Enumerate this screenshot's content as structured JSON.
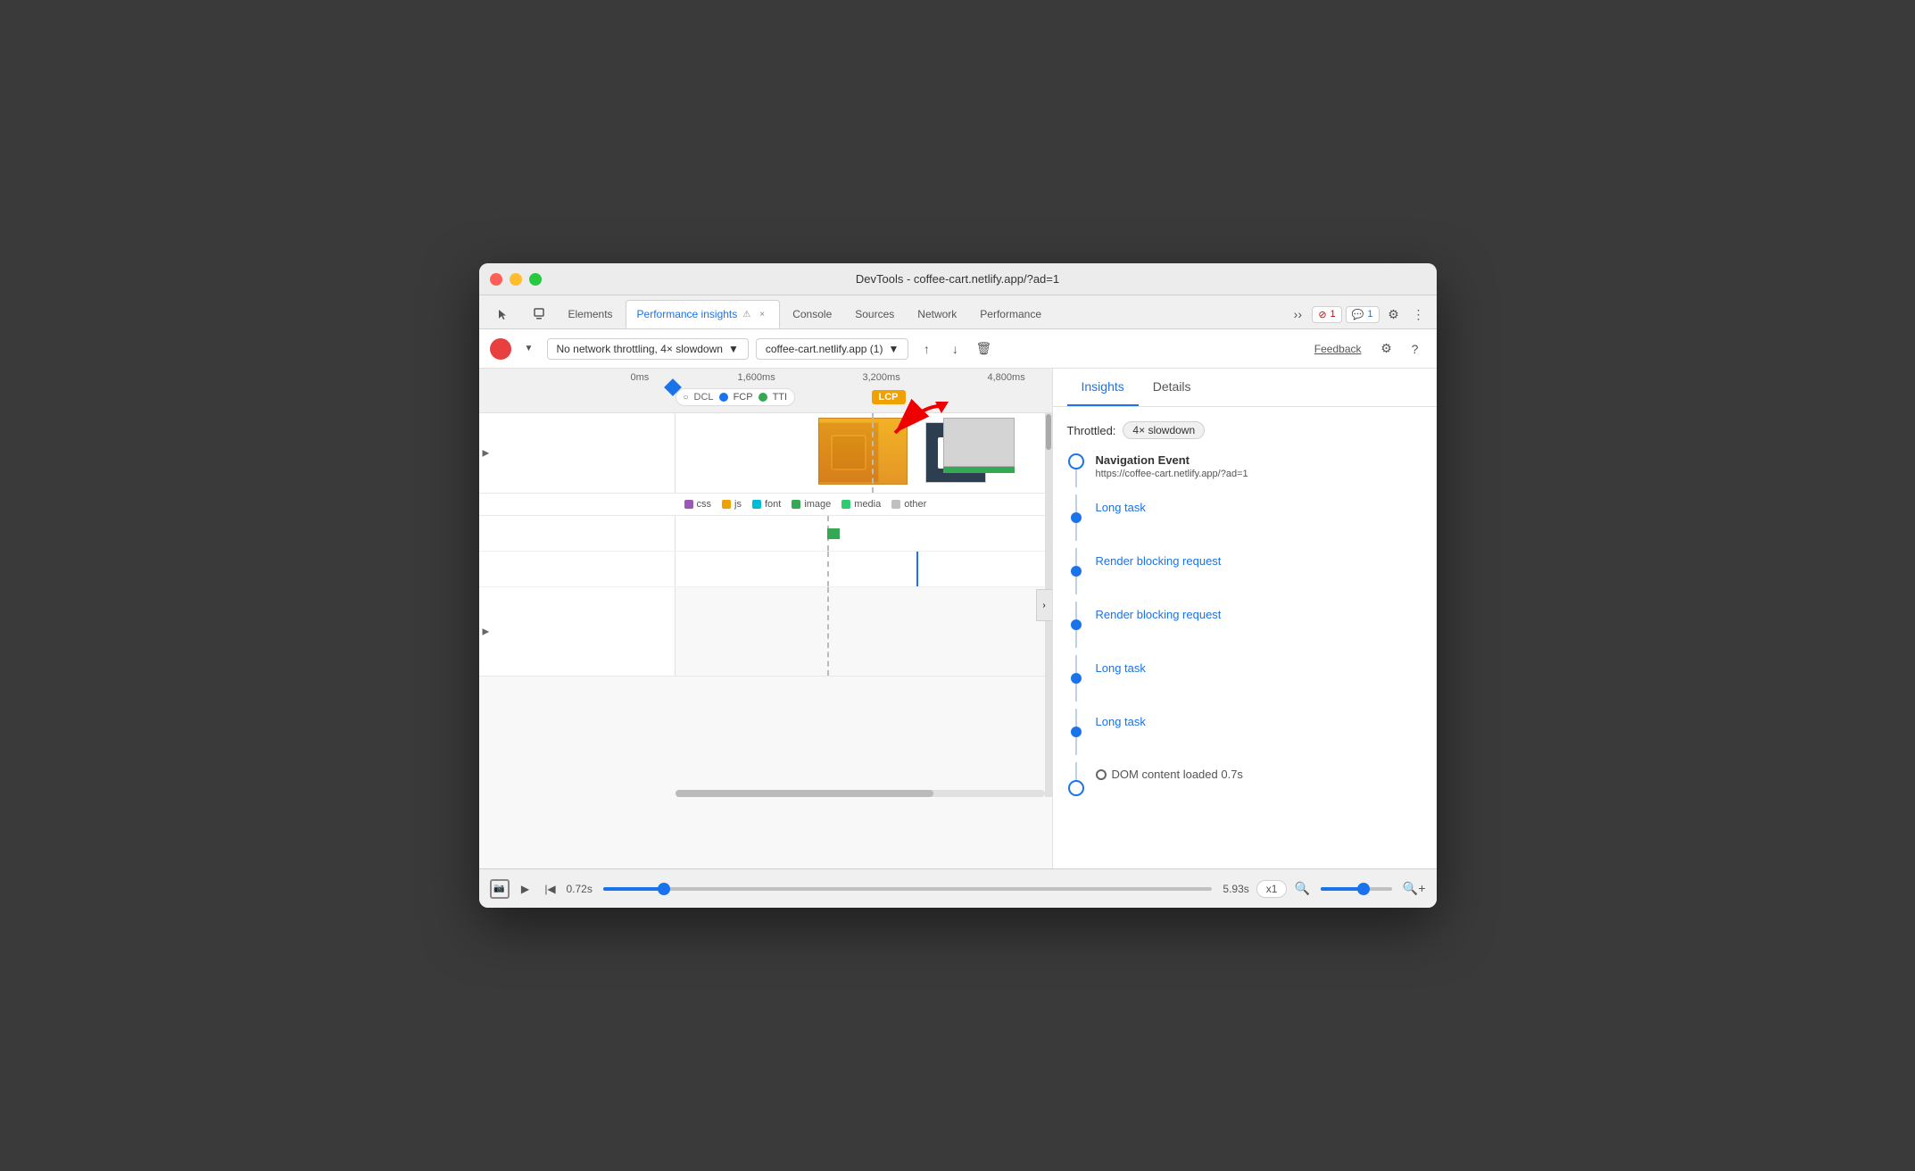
{
  "window": {
    "title": "DevTools - coffee-cart.netlify.app/?ad=1"
  },
  "tabs": [
    {
      "id": "cursor",
      "label": "",
      "icon": "cursor"
    },
    {
      "id": "elements",
      "label": "Elements"
    },
    {
      "id": "performance-insights",
      "label": "Performance insights",
      "active": true
    },
    {
      "id": "console",
      "label": "Console"
    },
    {
      "id": "sources",
      "label": "Sources"
    },
    {
      "id": "network",
      "label": "Network"
    },
    {
      "id": "performance",
      "label": "Performance"
    }
  ],
  "toolbar": {
    "record_label": "",
    "throttling": "No network throttling, 4× slowdown",
    "url": "coffee-cart.netlify.app (1)",
    "feedback_label": "Feedback"
  },
  "timeline": {
    "timestamps": [
      "0ms",
      "1,600ms",
      "3,200ms",
      "4,800ms"
    ],
    "milestones": [
      "DCL",
      "FCP",
      "TTI"
    ],
    "lcp_label": "LCP"
  },
  "right_panel": {
    "tabs": [
      "Insights",
      "Details"
    ],
    "active_tab": "Insights",
    "throttled_label": "Throttled:",
    "throttle_value": "4× slowdown",
    "events": [
      {
        "type": "navigation",
        "title": "Navigation Event",
        "url": "https://coffee-cart.netlify.app/?ad=1",
        "circle": "outline"
      },
      {
        "type": "long-task",
        "title": "Long task",
        "is_link": true,
        "circle": "filled"
      },
      {
        "type": "render-blocking",
        "title": "Render blocking request",
        "is_link": true,
        "circle": "filled"
      },
      {
        "type": "render-blocking-2",
        "title": "Render blocking request",
        "is_link": true,
        "circle": "filled"
      },
      {
        "type": "long-task-2",
        "title": "Long task",
        "is_link": true,
        "circle": "filled"
      },
      {
        "type": "long-task-3",
        "title": "Long task",
        "is_link": true,
        "circle": "filled"
      },
      {
        "type": "dom-content",
        "title": "DOM content loaded 0.7s",
        "circle": "outline"
      }
    ]
  },
  "legend": {
    "items": [
      {
        "label": "css",
        "color": "#9b59b6"
      },
      {
        "label": "js",
        "color": "#f0a000"
      },
      {
        "label": "font",
        "color": "#00bcd4"
      },
      {
        "label": "image",
        "color": "#34a853"
      },
      {
        "label": "media",
        "color": "#2ecc71"
      },
      {
        "label": "other",
        "color": "#c0c0c0"
      }
    ]
  },
  "bottom_bar": {
    "start_time": "0.72s",
    "end_time": "5.93s",
    "speed": "x1"
  },
  "badges": {
    "errors": "1",
    "messages": "1"
  }
}
